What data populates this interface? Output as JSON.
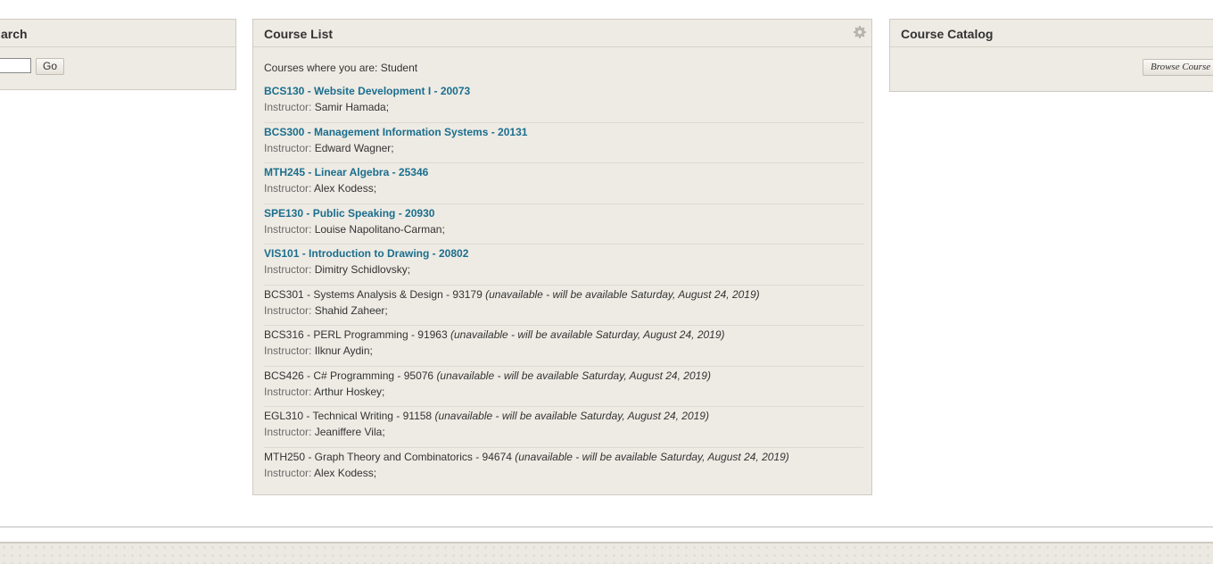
{
  "search_module": {
    "title": "Course Search",
    "title_visible": "arch",
    "go_label": "Go",
    "input_value": ""
  },
  "course_list": {
    "title": "Course List",
    "role_line": "Courses where you are: Student",
    "instructor_label": "Instructor:",
    "courses": [
      {
        "name": "BCS130 - Website Development I - 20073",
        "instructor": "Samir Hamada;",
        "available": true,
        "note": ""
      },
      {
        "name": "BCS300 - Management Information Systems - 20131",
        "instructor": "Edward Wagner;",
        "available": true,
        "note": ""
      },
      {
        "name": "MTH245 - Linear Algebra - 25346",
        "instructor": "Alex Kodess;",
        "available": true,
        "note": ""
      },
      {
        "name": "SPE130 - Public Speaking - 20930",
        "instructor": "Louise Napolitano-Carman;",
        "available": true,
        "note": ""
      },
      {
        "name": "VIS101 - Introduction to Drawing - 20802",
        "instructor": "Dimitry Schidlovsky;",
        "available": true,
        "note": ""
      },
      {
        "name": "BCS301 - Systems Analysis & Design - 93179",
        "instructor": "Shahid Zaheer;",
        "available": false,
        "note": "(unavailable - will be available Saturday, August 24, 2019)"
      },
      {
        "name": "BCS316 - PERL Programming - 91963",
        "instructor": "Ilknur Aydin;",
        "available": false,
        "note": "(unavailable - will be available Saturday, August 24, 2019)"
      },
      {
        "name": "BCS426 - C# Programming - 95076",
        "instructor": "Arthur Hoskey;",
        "available": false,
        "note": "(unavailable - will be available Saturday, August 24, 2019)"
      },
      {
        "name": "EGL310 - Technical Writing - 91158",
        "instructor": "Jeaniffere Vila;",
        "available": false,
        "note": "(unavailable - will be available Saturday, August 24, 2019)"
      },
      {
        "name": "MTH250 - Graph Theory and Combinatorics - 94674",
        "instructor": "Alex Kodess;",
        "available": false,
        "note": "(unavailable - will be available Saturday, August 24, 2019)"
      }
    ]
  },
  "catalog_module": {
    "title": "Course Catalog",
    "browse_label": "Browse Course Catalog"
  },
  "colors": {
    "module_bg": "#eeebe4",
    "link": "#1a6e8e",
    "border": "#cfcbc2"
  },
  "icons": {
    "module_settings": "gear-icon"
  }
}
